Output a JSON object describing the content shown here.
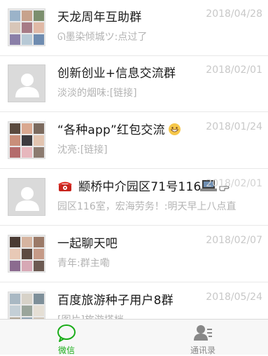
{
  "chats": [
    {
      "title": "天龙周年互助群",
      "date": "2018/04/28",
      "preview": "ᘏ墨染倾城ツ:点过了",
      "avatar": "group"
    },
    {
      "title": "创新创业+信息交流群",
      "date": "2018/02/01",
      "preview": "淡淡的烟味:[链接]",
      "avatar": "default"
    },
    {
      "title": "“各种app”红包交流",
      "date": "2018/01/24",
      "preview": "沈亮:[链接]",
      "avatar": "group",
      "emoji": "grinning-face-icon"
    },
    {
      "title": "颛桥中介园区71号116",
      "date": "2018/02/01",
      "preview": "园区116室，宏海劳务！:明天早上八点直",
      "avatar": "default",
      "prefix_icon": "telephone-icon",
      "suffix_icons": [
        "laptop-icon",
        "pointing-hand-icon"
      ]
    },
    {
      "title": "一起聊天吧",
      "date": "2018/02/07",
      "preview": "青年:群主嘞",
      "avatar": "group"
    },
    {
      "title": "百度旅游种子用户8群",
      "date": "2018/05/24",
      "preview": "[图片]旅游搭档",
      "avatar": "group"
    }
  ],
  "tabbar": {
    "tabs": [
      {
        "label": "微信",
        "icon": "chat-bubble-icon",
        "active": true
      },
      {
        "label": "通讯录",
        "icon": "contacts-icon",
        "active": false
      }
    ],
    "active_color": "#1aad19",
    "inactive_color": "#888888"
  }
}
